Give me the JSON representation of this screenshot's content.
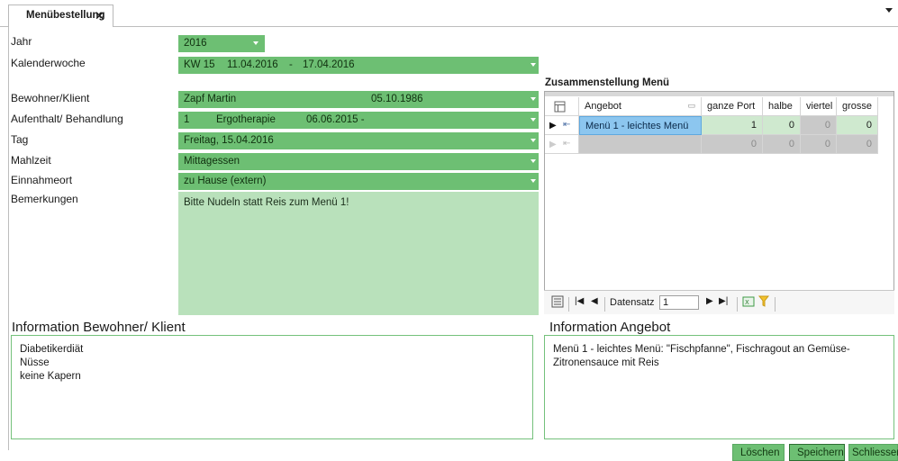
{
  "tab": {
    "title": "Menübestellung",
    "close_glyph": "✕"
  },
  "form": {
    "jahr": {
      "label": "Jahr",
      "value": "2016"
    },
    "kalenderwoche": {
      "label": "Kalenderwoche",
      "kw": "KW 15",
      "start": "11.04.2016",
      "sep": "-",
      "end": "17.04.2016"
    },
    "bewohner": {
      "label": "Bewohner/Klient",
      "name": "Zapf Martin",
      "birth": "05.10.1986"
    },
    "aufenthalt": {
      "label": "Aufenthalt/ Behandlung",
      "nr": "1",
      "type": "Ergotherapie",
      "date": "06.06.2015 -"
    },
    "tag": {
      "label": "Tag",
      "value": "Freitag, 15.04.2016"
    },
    "mahlzeit": {
      "label": "Mahlzeit",
      "value": "Mittagessen"
    },
    "einnahmeort": {
      "label": "Einnahmeort",
      "value": "zu Hause (extern)"
    },
    "bemerkungen": {
      "label": "Bemerkungen",
      "value": "Bitte Nudeln statt Reis zum Menü 1!"
    }
  },
  "zusammenstellung": {
    "title": "Zusammenstellung Menü",
    "columns": [
      "Angebot",
      "ganze Port",
      "halbe",
      "viertel",
      "grosse"
    ],
    "rows": [
      {
        "angebot": "Menü 1 - leichtes Menü",
        "ganze": "1",
        "halbe": "0",
        "viertel": "0",
        "grosse": "0"
      },
      {
        "angebot": "",
        "ganze": "0",
        "halbe": "0",
        "viertel": "0",
        "grosse": "0"
      }
    ],
    "nav": {
      "label": "Datensatz",
      "value": "1"
    }
  },
  "info_bewohner": {
    "title": "Information Bewohner/ Klient",
    "lines": [
      "Diabetikerdiät",
      "Nüsse",
      "keine Kapern"
    ]
  },
  "info_angebot": {
    "title": "Information Angebot",
    "lines": [
      "Menü 1 - leichtes Menü: \"Fischpfanne\", Fischragout an Gemüse-",
      "Zitronensauce mit Reis"
    ]
  },
  "buttons": {
    "loeschen": "Löschen",
    "speichern": "Speichern",
    "schliessen": "Schliessen"
  },
  "colors": {
    "field_green": "#6dbf73",
    "light_green": "#b9e1bb",
    "selection_blue": "#8cc6ef"
  }
}
